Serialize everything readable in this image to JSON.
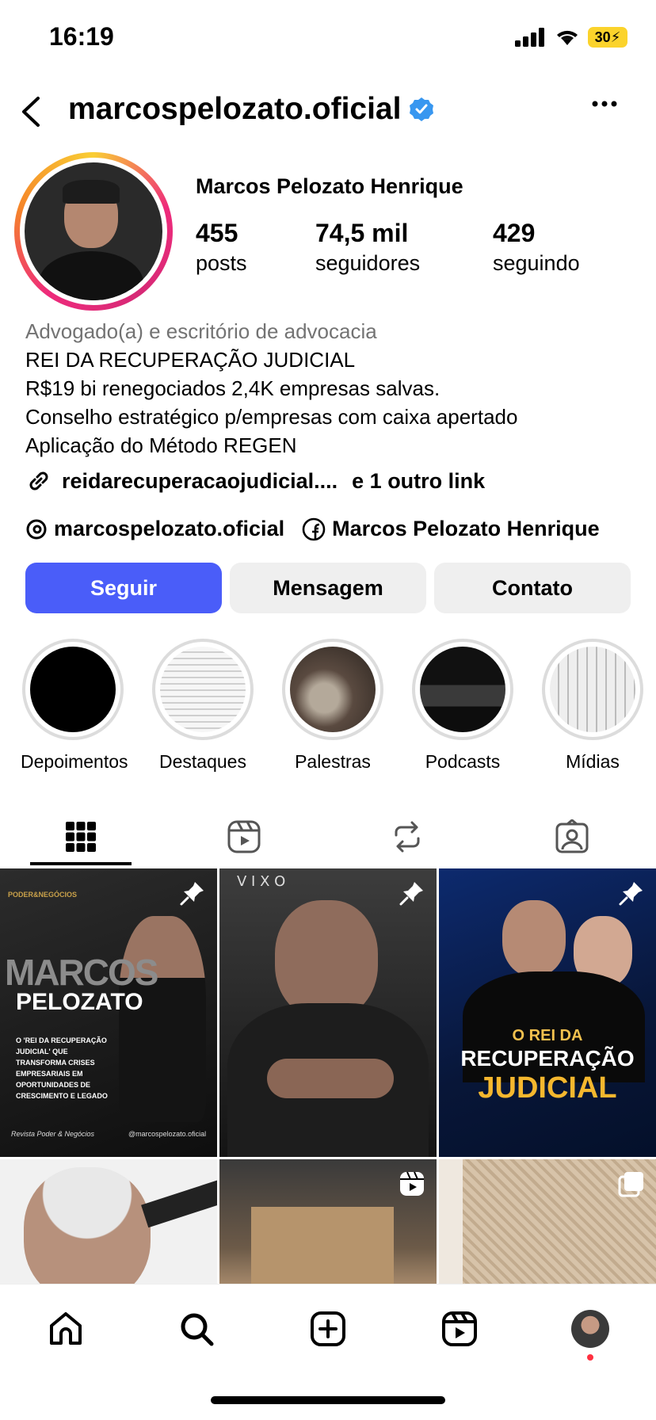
{
  "status": {
    "time": "16:19",
    "battery": "30"
  },
  "profile": {
    "handle": "marcospelozato.oficial",
    "full_name": "Marcos Pelozato Henrique",
    "stats": [
      {
        "num": "455",
        "label": "posts"
      },
      {
        "num": "74,5 mil",
        "label": "seguidores"
      },
      {
        "num": "429",
        "label": "seguindo"
      }
    ],
    "category": "Advogado(a) e escritório de advocacia",
    "bio_lines": [
      "REI DA RECUPERAÇÃO JUDICIAL",
      "R$19 bi renegociados 2,4K empresas salvas.",
      "Conselho estratégico p/empresas com caixa apertado",
      "Aplicação do Método REGEN"
    ],
    "link_text": "reidarecuperacaojudicial....",
    "link_more": "e 1 outro link",
    "threads_name": "marcospelozato.oficial",
    "facebook_name": "Marcos Pelozato Henrique"
  },
  "buttons": {
    "follow": "Seguir",
    "message": "Mensagem",
    "contact": "Contato"
  },
  "highlights": [
    "Depoimentos",
    "Destaques",
    "Palestras",
    "Podcasts",
    "Mídias"
  ],
  "posts": {
    "p1_brand": "PODER&NEGÓCIOS",
    "p1_title1": "MARCOS",
    "p1_title2": "PELOZATO",
    "p1_text": "O 'REI DA RECUPERAÇÃO JUDICIAL' QUE TRANSFORMA CRISES EMPRESARIAIS EM OPORTUNIDADES DE CRESCIMENTO E LEGADO",
    "p1_foot_left": "Revista Poder & Negócios",
    "p1_foot_right": "@marcospelozato.oficial",
    "p2_brand": "V I X O",
    "p3_small": "O REI DA",
    "p3_mid": "RECUPERAÇÃO",
    "p3_big": "JUDICIAL"
  },
  "colors": {
    "follow": "#4a5df9",
    "verified": "#3897f0",
    "battery": "#fbd32b"
  }
}
